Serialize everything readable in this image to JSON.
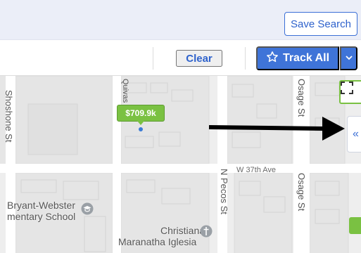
{
  "header": {
    "save_search_label": "Save Search"
  },
  "toolbar": {
    "clear_label": "Clear",
    "track_all_label": "Track All"
  },
  "map": {
    "streets": {
      "osage_top": "Osage St",
      "osage_bottom": "Osage St",
      "w37th": "W 37th Ave",
      "pecos": "N Pecos St",
      "left_top": "Shoshone St",
      "mid_top": "Quivas St"
    },
    "pois": {
      "school_line1": "Bryant-Webster",
      "school_line2": "mentary School",
      "church_line1": "Christiana",
      "church_line2": "Maranatha Iglesia"
    },
    "listing": {
      "price": "$709.9k"
    },
    "collapse_glyph": "«"
  },
  "colors": {
    "accent": "#3f74d8",
    "listing_green": "#7ac142",
    "map_bg": "#eeeeee"
  }
}
